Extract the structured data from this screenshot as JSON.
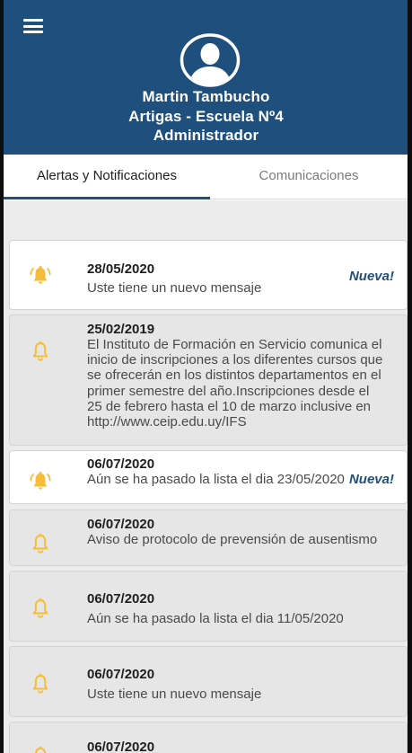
{
  "header": {
    "menu_icon": "hamburger-menu-icon",
    "avatar_icon": "user-avatar-icon",
    "user_name": "Martin Tambucho",
    "school": "Artigas - Escuela Nº4",
    "role": "Administrador",
    "background_color": "#1f4f7c"
  },
  "tabs": [
    {
      "label": "Alertas y Notificaciones",
      "active": true
    },
    {
      "label": "Comunicaciones",
      "active": false
    }
  ],
  "accent_color": "#1f4f7c",
  "bell_color": "#f5bd3a",
  "notifications": [
    {
      "date": "28/05/2020",
      "message": "Uste tiene un nuevo mensaje",
      "badge": "Nueva!",
      "icon": "bell-ringing-icon"
    },
    {
      "date": "25/02/2019",
      "message": "El Instituto de Formación en Servicio comunica el inicio de inscripciones a los diferentes cursos que se ofrecerán en los distintos departamentos en el primer semestre del año.Inscripciones desde el 25 de febrero hasta el 10 de marzo inclusive en http://www.ceip.edu.uy/IFS",
      "icon": "bell-icon"
    },
    {
      "date": "06/07/2020",
      "message": "Aún se ha pasado la lista el dia 23/05/2020",
      "badge": "Nueva!",
      "icon": "bell-ringing-icon"
    },
    {
      "date": "06/07/2020",
      "message": "Aviso de protocolo de prevensión de ausentismo",
      "icon": "bell-icon"
    },
    {
      "date": "06/07/2020",
      "message": "Aún se ha pasado la lista el dia 11/05/2020",
      "icon": "bell-icon"
    },
    {
      "date": "06/07/2020",
      "message": "Uste tiene un nuevo mensaje",
      "icon": "bell-icon"
    },
    {
      "date": "06/07/2020",
      "icon": "bell-icon"
    }
  ]
}
